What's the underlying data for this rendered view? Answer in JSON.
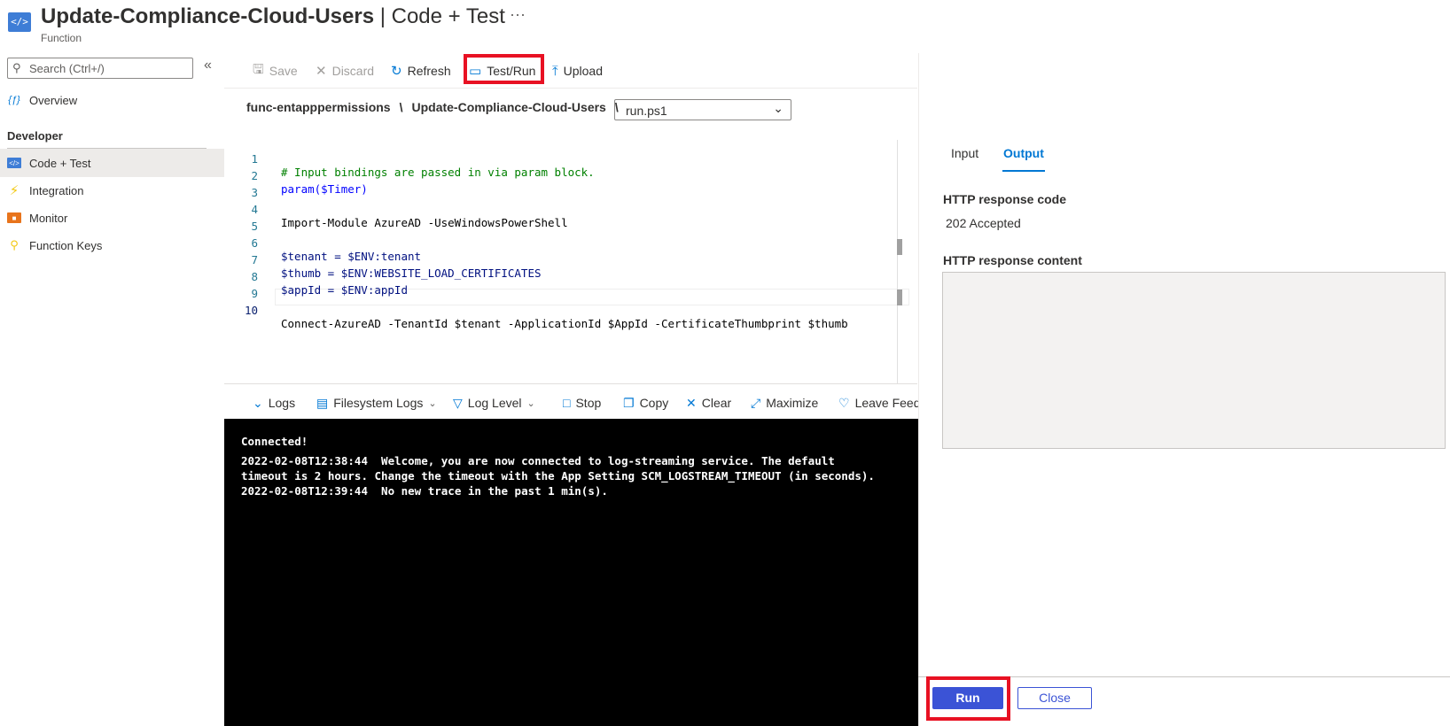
{
  "header": {
    "title": "Update-Compliance-Cloud-Users",
    "title_separator": " | Code + Test",
    "subtitle": "Function",
    "more_label": "···"
  },
  "sidebar": {
    "search_placeholder": "Search (Ctrl+/)",
    "collapse_label": "«",
    "overview_label": "Overview",
    "section_developer": "Developer",
    "items": [
      {
        "label": "Code + Test",
        "icon": "code-icon",
        "active": true
      },
      {
        "label": "Integration",
        "icon": "lightning-icon",
        "active": false
      },
      {
        "label": "Monitor",
        "icon": "monitor-icon",
        "active": false
      },
      {
        "label": "Function Keys",
        "icon": "key-icon",
        "active": false
      }
    ]
  },
  "toolbar": {
    "save_label": "Save",
    "discard_label": "Discard",
    "refresh_label": "Refresh",
    "testrun_label": "Test/Run",
    "upload_label": "Upload"
  },
  "breadcrumb": {
    "app": "func-entapppermissions",
    "sep1": "\\",
    "function": "Update-Compliance-Cloud-Users",
    "sep2": "\\",
    "file": "run.ps1"
  },
  "code": {
    "lines": [
      "# Input bindings are passed in via param block.",
      "param($Timer)",
      "",
      "Import-Module AzureAD -UseWindowsPowerShell",
      "",
      "$tenant = $ENV:tenant",
      "$thumb = $ENV:WEBSITE_LOAD_CERTIFICATES",
      "$appId = $ENV:appId",
      "",
      "Connect-AzureAD -TenantId $tenant -ApplicationId $AppId -CertificateThumbprint $thumb"
    ],
    "line_numbers": [
      "1",
      "2",
      "3",
      "4",
      "5",
      "6",
      "7",
      "8",
      "9",
      "10"
    ]
  },
  "logbar": {
    "logs_label": "Logs",
    "filesystem_label": "Filesystem Logs",
    "loglevel_label": "Log Level",
    "stop_label": "Stop",
    "copy_label": "Copy",
    "clear_label": "Clear",
    "maximize_label": "Maximize",
    "feedback_label": "Leave Feedback"
  },
  "console": {
    "lines": [
      "Connected!",
      "2022-02-08T12:38:44  Welcome, you are now connected to log-streaming service. The default",
      "timeout is 2 hours. Change the timeout with the App Setting SCM_LOGSTREAM_TIMEOUT (in seconds).",
      "2022-02-08T12:39:44  No new trace in the past 1 min(s)."
    ]
  },
  "panel": {
    "tab_input": "Input",
    "tab_output": "Output",
    "response_code_label": "HTTP response code",
    "response_code_value": "202 Accepted",
    "response_content_label": "HTTP response content",
    "run_label": "Run",
    "close_label": "Close"
  },
  "colors": {
    "accent": "#0078d4",
    "highlight": "#e81123",
    "run_button": "#3b53d6"
  }
}
